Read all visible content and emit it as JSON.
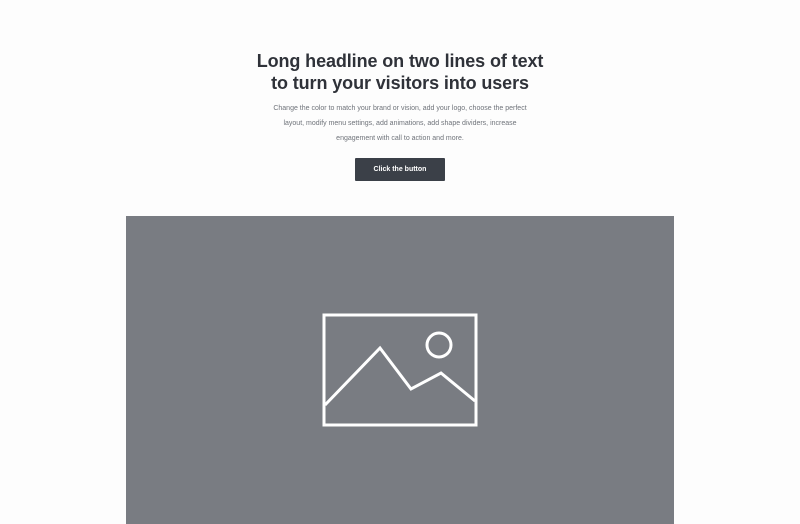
{
  "hero": {
    "headline_line1": "Long headline on two lines of text",
    "headline_line2": "to turn your visitors into users",
    "subtitle": "Change the color to match your brand or vision, add your logo, choose the perfect layout, modify menu settings, add animations, add shape dividers, increase engagement with call to action and more.",
    "button_label": "Click the button"
  },
  "media": {
    "icon": "image-placeholder-icon"
  },
  "colors": {
    "background": "#fdfdfd",
    "headline": "#2f3239",
    "subtitle": "#6f737a",
    "button_bg": "#3b4048",
    "button_text": "#ffffff",
    "media_bg": "#797c82",
    "icon_stroke": "#ffffff"
  }
}
